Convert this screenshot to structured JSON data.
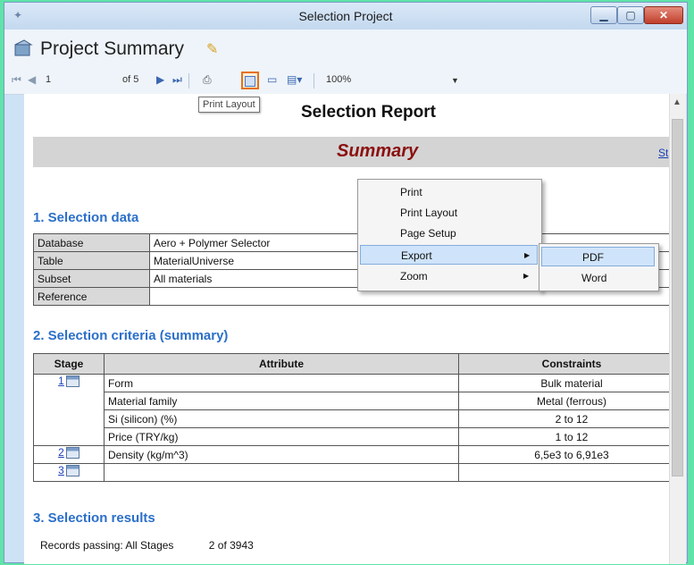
{
  "window": {
    "title": "Selection Project"
  },
  "header": {
    "title": "Project Summary"
  },
  "toolbar": {
    "page_current": "1",
    "page_of": "of 5",
    "zoom": "100%",
    "tooltip": "Print Layout"
  },
  "report": {
    "title": "Selection Report",
    "band_title": "Summary",
    "band_link": "St",
    "section1": {
      "title": "1. Selection data",
      "rows": [
        {
          "key": "Database",
          "value": "Aero + Polymer Selector"
        },
        {
          "key": "Table",
          "value": "MaterialUniverse"
        },
        {
          "key": "Subset",
          "value": "All materials"
        },
        {
          "key": "Reference",
          "value": ""
        }
      ]
    },
    "section2": {
      "title": "2. Selection criteria (summary)",
      "headers": [
        "Stage",
        "Attribute",
        "Constraints"
      ],
      "stages": [
        "1",
        "2",
        "3"
      ],
      "rows": [
        {
          "attribute": "Form",
          "constraint": "Bulk material"
        },
        {
          "attribute": "Material family",
          "constraint": "Metal (ferrous)"
        },
        {
          "attribute": "Si (silicon) (%)",
          "constraint": "2 to 12"
        },
        {
          "attribute": "Price (TRY/kg)",
          "constraint": "1 to 12"
        },
        {
          "attribute": "Density (kg/m^3)",
          "constraint": "6,5e3 to 6,91e3"
        },
        {
          "attribute": "",
          "constraint": ""
        }
      ]
    },
    "section3": {
      "title": "3. Selection results",
      "records_label": "Records passing:  All Stages",
      "records_value": "2 of 3943"
    }
  },
  "context_menu": {
    "items": [
      "Print",
      "Print Layout",
      "Page Setup",
      "Export",
      "Zoom"
    ],
    "submenu": [
      "PDF",
      "Word"
    ]
  },
  "colors": {
    "summary_text": "#8b1010",
    "section_heading": "#2b6fc9",
    "highlight": "#e8701a"
  }
}
